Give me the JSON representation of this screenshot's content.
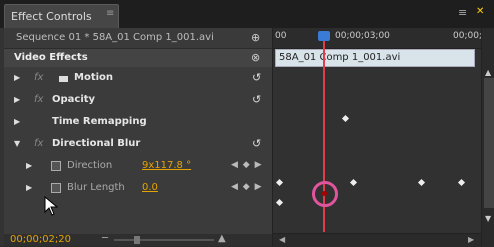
{
  "panel": {
    "tab_label": "Effect Controls",
    "tab_menu_icon": "≡",
    "panel_menu_icon": "≡"
  },
  "header": {
    "sequence_label": "Sequence 01 * 58A_01 Comp 1_001.avi",
    "sequence_icon": "link-icon"
  },
  "video_effects": {
    "label": "Video Effects",
    "items": [
      {
        "name": "Motion"
      },
      {
        "name": "Opacity"
      },
      {
        "name": "Time Remapping"
      },
      {
        "name": "Directional Blur"
      }
    ]
  },
  "params": [
    {
      "name": "Direction",
      "value": "9x117.8 °"
    },
    {
      "name": "Blur Length",
      "value": "0.0"
    }
  ],
  "timeline": {
    "t_start": "00",
    "t_mid": "00;00;03;00",
    "t_end": "00;00;",
    "clip": "58A_01 Comp 1_001.avi"
  },
  "bottom": {
    "timecode": "00;00;02;20"
  },
  "colors": {
    "accent_value": "#e6a400",
    "playhead": "#e03c4a",
    "highlight_circle": "#e0559d"
  }
}
